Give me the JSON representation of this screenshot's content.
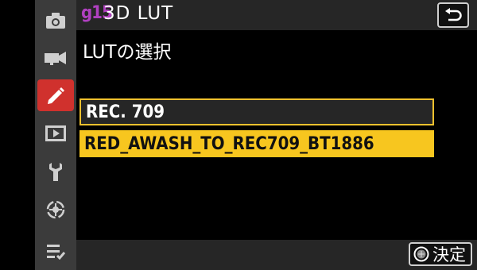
{
  "header": {
    "code": "g15",
    "title": "3D LUT"
  },
  "subtitle": "LUTの選択",
  "options": [
    {
      "label": "REC. 709",
      "state": "current"
    },
    {
      "label": "RED_AWASH_TO_REC709_BT1886",
      "state": "highlighted"
    }
  ],
  "footer": {
    "ok_label": "決定"
  },
  "sidebar": {
    "items": [
      {
        "icon": "camera-icon"
      },
      {
        "icon": "movie-camera-icon"
      },
      {
        "icon": "pencil-icon",
        "active": true
      },
      {
        "icon": "playback-icon"
      },
      {
        "icon": "wrench-icon"
      },
      {
        "icon": "network-icon"
      },
      {
        "icon": "my-menu-icon"
      }
    ]
  },
  "colors": {
    "accent_tab": "#d0312d",
    "highlight": "#f7c61f",
    "code_purple": "#b040c0",
    "panel_gray": "#262626"
  }
}
